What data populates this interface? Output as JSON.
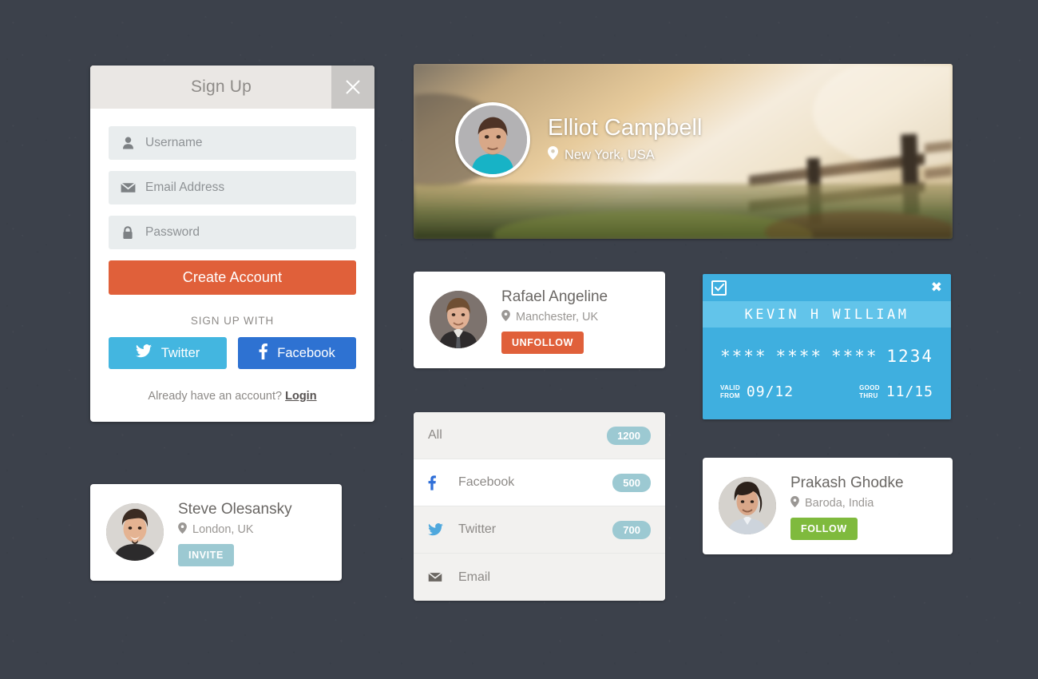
{
  "signup": {
    "title": "Sign Up",
    "close_icon": "close-x-icon",
    "fields": [
      {
        "icon": "user-icon",
        "placeholder": "Username",
        "value": ""
      },
      {
        "icon": "envelope-icon",
        "placeholder": "Email Address",
        "value": ""
      },
      {
        "icon": "lock-icon",
        "placeholder": "Password",
        "value": ""
      }
    ],
    "create_label": "Create Account",
    "divider_label": "SIGN UP WITH",
    "twitter_label": "Twitter",
    "facebook_label": "Facebook",
    "already_text": "Already have an account?",
    "login_label": "Login",
    "colors": {
      "header_bg": "#eae7e4",
      "close_bg": "#c9c7c5",
      "create_btn": "#e0603a",
      "twitter_btn": "#43b6e0",
      "facebook_btn": "#2e72d2",
      "field_bg": "#e9edee"
    }
  },
  "banner": {
    "name": "Elliot Campbell",
    "location": "New York, USA",
    "location_icon": "map-pin-icon",
    "avatar_name": "avatar-elliot-campbell"
  },
  "cards": {
    "rafael": {
      "name": "Rafael Angeline",
      "location": "Manchester, UK",
      "location_icon": "map-pin-icon",
      "button_label": "UNFOLLOW",
      "button_color": "#e0603a",
      "avatar_name": "avatar-rafael-angeline"
    },
    "steve": {
      "name": "Steve Olesansky",
      "location": "London, UK",
      "location_icon": "map-pin-icon",
      "button_label": "INVITE",
      "button_color": "#9cc9d2",
      "avatar_name": "avatar-steve-olesansky"
    },
    "prakash": {
      "name": "Prakash Ghodke",
      "location": "Baroda, India",
      "location_icon": "map-pin-icon",
      "button_label": "FOLLOW",
      "button_color": "#7fba3d",
      "avatar_name": "avatar-prakash-ghodke"
    }
  },
  "social_list": {
    "rows": [
      {
        "icon": null,
        "label": "All",
        "badge": "1200"
      },
      {
        "icon": "facebook-icon",
        "label": "Facebook",
        "badge": "500"
      },
      {
        "icon": "twitter-icon",
        "label": "Twitter",
        "badge": "700"
      },
      {
        "icon": "envelope-icon",
        "label": "Email",
        "badge": null
      }
    ],
    "badge_color": "#9cc9d2"
  },
  "credit_card": {
    "checkbox_icon": "checkbox-checked-icon",
    "close_icon": "close-x-icon",
    "holder_name": "KEVIN H WILLIAM",
    "number_groups": [
      "****",
      "****",
      "****",
      "1234"
    ],
    "valid_from_label": "VALID\nFROM",
    "valid_from_line1": "VALID",
    "valid_from_line2": "FROM",
    "valid_from_value": "09/12",
    "good_thru_line1": "GOOD",
    "good_thru_line2": "THRU",
    "good_thru_value": "11/15",
    "bg_color": "#3fafdf",
    "name_bar_color": "#62c4ea"
  }
}
